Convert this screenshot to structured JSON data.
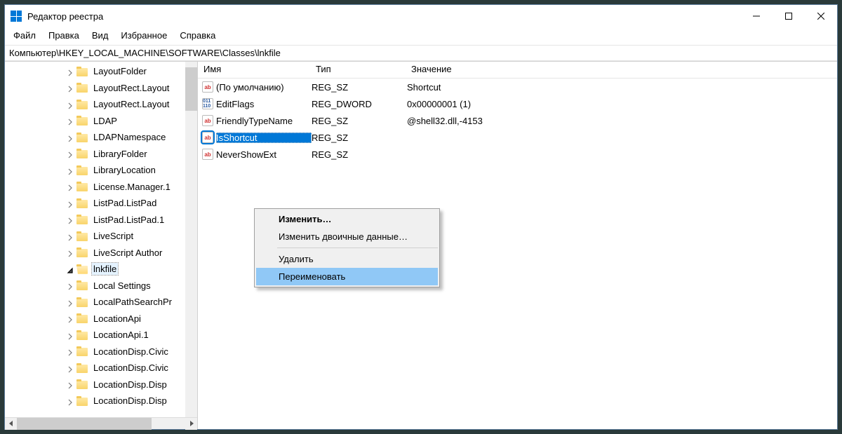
{
  "window": {
    "title": "Редактор реестра"
  },
  "menu": {
    "file": "Файл",
    "edit": "Правка",
    "view": "Вид",
    "favorites": "Избранное",
    "help": "Справка"
  },
  "address": "Компьютер\\HKEY_LOCAL_MACHINE\\SOFTWARE\\Classes\\lnkfile",
  "columns": {
    "name": "Имя",
    "type": "Тип",
    "value": "Значение"
  },
  "tree": [
    {
      "label": "LayoutFolder",
      "selected": false
    },
    {
      "label": "LayoutRect.Layout",
      "selected": false
    },
    {
      "label": "LayoutRect.Layout",
      "selected": false
    },
    {
      "label": "LDAP",
      "selected": false
    },
    {
      "label": "LDAPNamespace",
      "selected": false
    },
    {
      "label": "LibraryFolder",
      "selected": false
    },
    {
      "label": "LibraryLocation",
      "selected": false
    },
    {
      "label": "License.Manager.1",
      "selected": false
    },
    {
      "label": "ListPad.ListPad",
      "selected": false
    },
    {
      "label": "ListPad.ListPad.1",
      "selected": false
    },
    {
      "label": "LiveScript",
      "selected": false
    },
    {
      "label": "LiveScript Author",
      "selected": false
    },
    {
      "label": "lnkfile",
      "selected": true
    },
    {
      "label": "Local Settings",
      "selected": false
    },
    {
      "label": "LocalPathSearchPr",
      "selected": false
    },
    {
      "label": "LocationApi",
      "selected": false
    },
    {
      "label": "LocationApi.1",
      "selected": false
    },
    {
      "label": "LocationDisp.Civic",
      "selected": false
    },
    {
      "label": "LocationDisp.Civic",
      "selected": false
    },
    {
      "label": "LocationDisp.Disp",
      "selected": false
    },
    {
      "label": "LocationDisp.Disp",
      "selected": false
    }
  ],
  "values": [
    {
      "icon": "str",
      "name": "(По умолчанию)",
      "type": "REG_SZ",
      "value": "Shortcut",
      "selected": false
    },
    {
      "icon": "bin",
      "name": "EditFlags",
      "type": "REG_DWORD",
      "value": "0x00000001 (1)",
      "selected": false
    },
    {
      "icon": "str",
      "name": "FriendlyTypeName",
      "type": "REG_SZ",
      "value": "@shell32.dll,-4153",
      "selected": false
    },
    {
      "icon": "str",
      "name": "IsShortcut",
      "type": "REG_SZ",
      "value": "",
      "selected": true
    },
    {
      "icon": "str",
      "name": "NeverShowExt",
      "type": "REG_SZ",
      "value": "",
      "selected": false
    }
  ],
  "context_menu": {
    "modify": "Изменить…",
    "modify_binary": "Изменить двоичные данные…",
    "delete": "Удалить",
    "rename": "Переименовать"
  }
}
